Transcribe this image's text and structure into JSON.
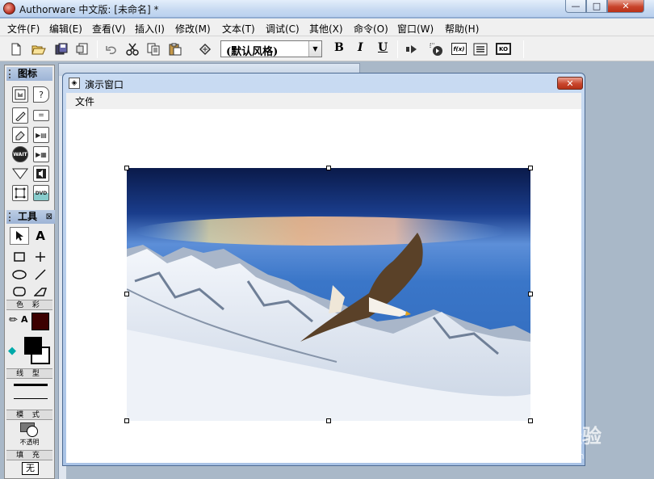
{
  "window": {
    "title": "Authorware 中文版: [未命名] *",
    "controls": {
      "minimize": "—",
      "maximize": "□",
      "close": "✕"
    }
  },
  "menu": {
    "items": [
      "文件(F)",
      "编辑(E)",
      "查看(V)",
      "插入(I)",
      "修改(M)",
      "文本(T)",
      "调试(C)",
      "其他(X)",
      "命令(O)",
      "窗口(W)",
      "帮助(H)"
    ]
  },
  "toolbar": {
    "style_selector": {
      "value": "(默认风格)"
    },
    "bold": "B",
    "italic": "I",
    "underline": "U",
    "icons": [
      "new-file-icon",
      "open-icon",
      "save-all-icon",
      "import-icon",
      "undo-icon",
      "cut-icon",
      "copy-icon",
      "paste-icon",
      "find-icon",
      "run-icon",
      "control-panel-icon",
      "function-icon",
      "variable-icon",
      "knowledge-object-icon"
    ]
  },
  "icon_palette": {
    "title": "图标",
    "icons": [
      "display-icon",
      "interaction-icon",
      "calculation-icon",
      "decision-icon",
      "erase-icon",
      "map-icon",
      "wait-icon",
      "movie-icon",
      "framework-icon",
      "sound-icon",
      "navigate-icon",
      "video-icon"
    ]
  },
  "tools_panel": {
    "title": "工具",
    "color_label": "色 彩",
    "line_label": "线 型",
    "mode_label": "模 式",
    "mode_value": "不透明",
    "fill_label": "填 充",
    "fill_value": "无",
    "colors": {
      "text_color": "#3c0000",
      "foreground": "#000000",
      "background": "#ffffff"
    }
  },
  "presentation_window": {
    "title": "演示窗口",
    "menu": {
      "file": "文件"
    }
  },
  "watermark": {
    "text": "Baidu经验",
    "url": "jingyan.baidu.com"
  }
}
